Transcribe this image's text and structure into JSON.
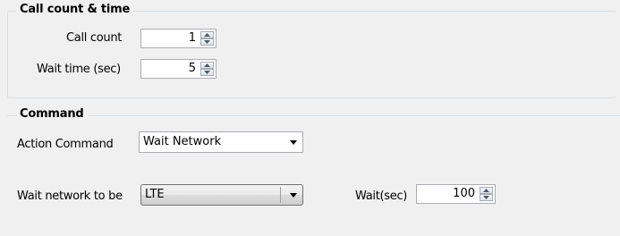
{
  "group_call": {
    "title": "Call count & time",
    "call_count_label": "Call count",
    "call_count_value": "1",
    "wait_time_label": "Wait time (sec)",
    "wait_time_value": "5"
  },
  "group_command": {
    "title": "Command",
    "action_command_label": "Action Command",
    "action_command_value": "Wait Network",
    "wait_network_label": "Wait network to be",
    "wait_network_value": "LTE",
    "wait_sec_label": "Wait(sec)",
    "wait_sec_value": "100"
  },
  "colors": {
    "background": "#f0f0f0",
    "group_border": "#d5dfe5",
    "input_border": "#abadb3"
  }
}
